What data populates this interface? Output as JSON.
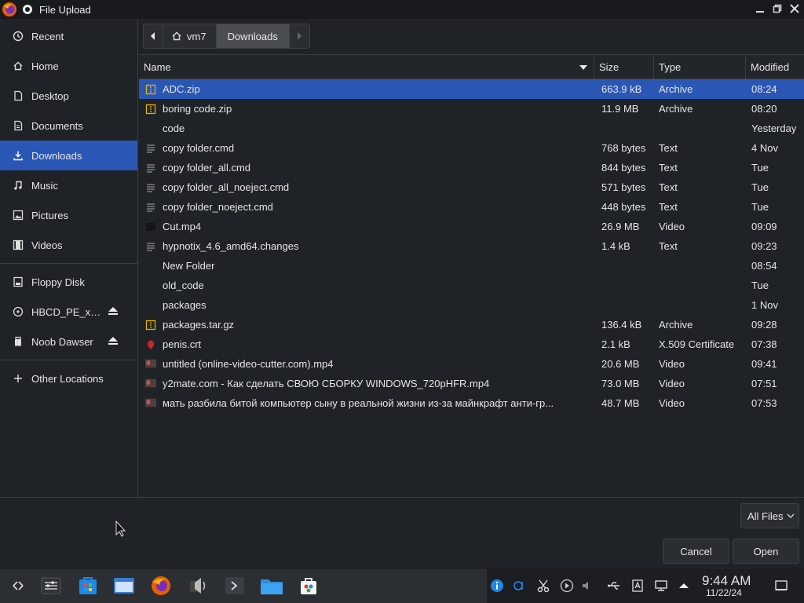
{
  "window": {
    "title": "File Upload"
  },
  "sidebar": {
    "items": [
      {
        "label": "Recent",
        "icon": "clock-icon"
      },
      {
        "label": "Home",
        "icon": "home-icon"
      },
      {
        "label": "Desktop",
        "icon": "desktop-icon"
      },
      {
        "label": "Documents",
        "icon": "document-icon"
      },
      {
        "label": "Downloads",
        "icon": "download-icon",
        "active": true
      },
      {
        "label": "Music",
        "icon": "music-icon"
      },
      {
        "label": "Pictures",
        "icon": "pictures-icon"
      },
      {
        "label": "Videos",
        "icon": "videos-icon"
      }
    ],
    "devices": [
      {
        "label": "Floppy Disk",
        "icon": "drive-icon"
      },
      {
        "label": "HBCD_PE_x…",
        "icon": "disc-icon",
        "eject": true
      },
      {
        "label": "Noob Dawser",
        "icon": "usb-icon",
        "eject": true
      }
    ],
    "other": {
      "label": "Other Locations",
      "icon": "plus-icon"
    }
  },
  "pathbar": {
    "home": "vm7",
    "current": "Downloads"
  },
  "columns": {
    "name": "Name",
    "size": "Size",
    "type": "Type",
    "modified": "Modified"
  },
  "files": [
    {
      "name": "ADC.zip",
      "size": "663.9 kB",
      "type": "Archive",
      "modified": "08:24",
      "icon": "archive-icon",
      "selected": true
    },
    {
      "name": "boring code.zip",
      "size": "11.9 MB",
      "type": "Archive",
      "modified": "08:20",
      "icon": "archive-icon"
    },
    {
      "name": "code",
      "size": "",
      "type": "",
      "modified": "Yesterday",
      "icon": "folder-icon"
    },
    {
      "name": "copy folder.cmd",
      "size": "768 bytes",
      "type": "Text",
      "modified": "4 Nov",
      "icon": "text-file-icon"
    },
    {
      "name": "copy folder_all.cmd",
      "size": "844 bytes",
      "type": "Text",
      "modified": "Tue",
      "icon": "text-file-icon"
    },
    {
      "name": "copy folder_all_noeject.cmd",
      "size": "571 bytes",
      "type": "Text",
      "modified": "Tue",
      "icon": "text-file-icon"
    },
    {
      "name": "copy folder_noeject.cmd",
      "size": "448 bytes",
      "type": "Text",
      "modified": "Tue",
      "icon": "text-file-icon"
    },
    {
      "name": "Cut.mp4",
      "size": "26.9 MB",
      "type": "Video",
      "modified": "09:09",
      "icon": "video-icon"
    },
    {
      "name": "hypnotix_4.6_amd64.changes",
      "size": "1.4 kB",
      "type": "Text",
      "modified": "09:23",
      "icon": "text-file-icon"
    },
    {
      "name": "New Folder",
      "size": "",
      "type": "",
      "modified": "08:54",
      "icon": "folder-icon"
    },
    {
      "name": "old_code",
      "size": "",
      "type": "",
      "modified": "Tue",
      "icon": "folder-icon"
    },
    {
      "name": "packages",
      "size": "",
      "type": "",
      "modified": "1 Nov",
      "icon": "folder-icon"
    },
    {
      "name": "packages.tar.gz",
      "size": "136.4 kB",
      "type": "Archive",
      "modified": "09:28",
      "icon": "archive-icon"
    },
    {
      "name": "penis.crt",
      "size": "2.1 kB",
      "type": "X.509 Certificate",
      "modified": "07:38",
      "icon": "certificate-icon"
    },
    {
      "name": "untitled (online-video-cutter.com).mp4",
      "size": "20.6 MB",
      "type": "Video",
      "modified": "09:41",
      "icon": "video-thumb-icon"
    },
    {
      "name": "y2mate.com - Как сделать СВОЮ СБОРКУ WINDOWS_720pHFR.mp4",
      "size": "73.0 MB",
      "type": "Video",
      "modified": "07:51",
      "icon": "video-thumb-icon"
    },
    {
      "name": "мать разбила битой компьютер сыну в реальной жизни из-за майнкрафт анти-гр...",
      "size": "48.7 MB",
      "type": "Video",
      "modified": "07:53",
      "icon": "video-thumb-icon"
    }
  ],
  "footer": {
    "filter": "All Files",
    "cancel": "Cancel",
    "open": "Open"
  },
  "taskbar": {
    "apps": [
      "overview-icon",
      "settings-icon",
      "store-icon",
      "file-manager-icon",
      "firefox-icon",
      "audio-icon",
      "terminal-icon",
      "folder-icon",
      "software-center-icon"
    ],
    "clock": {
      "time": "9:44 AM",
      "date": "11/22/24"
    }
  },
  "colors": {
    "accent": "#2a56b5",
    "background": "#1f2226",
    "titlebar": "#181a1d"
  }
}
